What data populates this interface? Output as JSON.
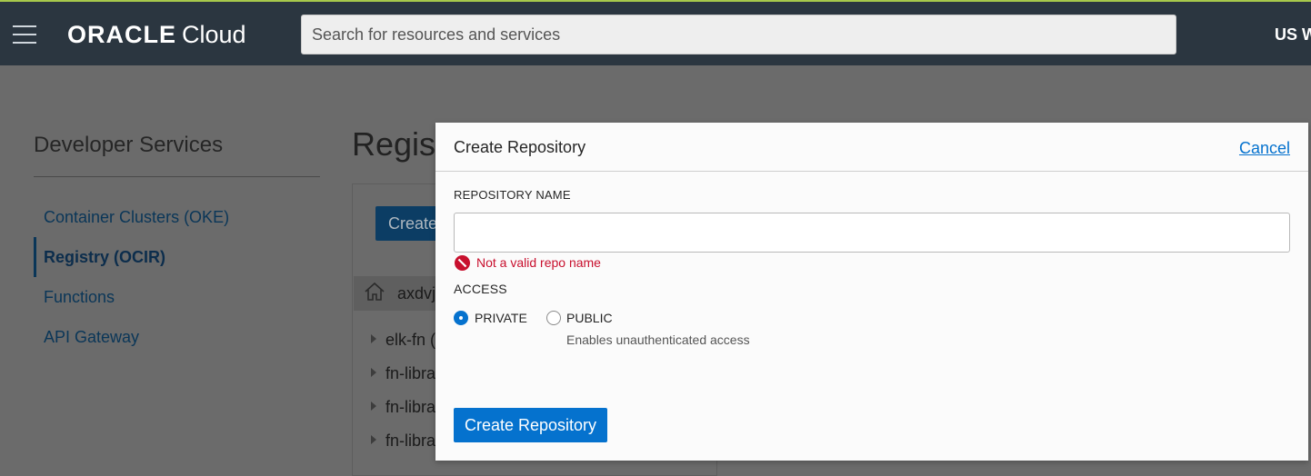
{
  "header": {
    "brand_oracle": "ORACLE",
    "brand_cloud": "Cloud",
    "search_placeholder": "Search for resources and services",
    "region": "US W"
  },
  "sidebar": {
    "title": "Developer Services",
    "items": [
      {
        "label": "Container Clusters (OKE)",
        "active": false
      },
      {
        "label": "Registry (OCIR)",
        "active": true
      },
      {
        "label": "Functions",
        "active": false
      },
      {
        "label": "API Gateway",
        "active": false
      }
    ]
  },
  "main": {
    "page_title": "Regist",
    "create_button_label": "Create",
    "compartment_label": "axdvj",
    "tree_items": [
      "elk-fn (",
      "fn-libra",
      "fn-libra",
      "fn-libra"
    ]
  },
  "dialog": {
    "title": "Create Repository",
    "cancel_label": "Cancel",
    "repo_name_label": "REPOSITORY NAME",
    "repo_name_value": "",
    "error_message": "Not a valid repo name",
    "access_label": "ACCESS",
    "private_label": "PRIVATE",
    "public_label": "PUBLIC",
    "public_help": "Enables unauthenticated access",
    "selected_access": "PRIVATE",
    "submit_label": "Create Repository"
  },
  "colors": {
    "topbar": "#2b3640",
    "accent_stripe": "#a7c84b",
    "primary_button": "#0572ce",
    "error": "#c8102e",
    "link": "#0572ce"
  }
}
